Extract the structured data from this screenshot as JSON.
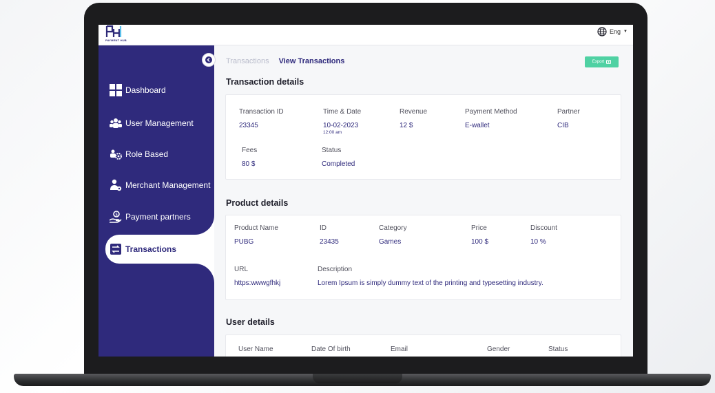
{
  "app": {
    "logo_text": "PAYMENT HUB",
    "language": "Eng"
  },
  "sidebar": {
    "items": [
      {
        "label": "Dashboard",
        "icon": "dashboard-icon"
      },
      {
        "label": "User Management",
        "icon": "users-icon"
      },
      {
        "label": "Role Based",
        "icon": "roles-icon"
      },
      {
        "label": "Merchant Management",
        "icon": "merchant-icon"
      },
      {
        "label": "Payment partners",
        "icon": "partner-icon"
      },
      {
        "label": "Transactions",
        "icon": "transactions-icon",
        "active": true
      }
    ]
  },
  "breadcrumb": {
    "parent": "Transactions",
    "current": "View Transactions"
  },
  "export_label": "Export",
  "transaction": {
    "title": "Transaction details",
    "fields": [
      {
        "label": "Transaction ID",
        "value": "23345"
      },
      {
        "label": "Time & Date",
        "value": "10-02-2023",
        "sub": "12:00 am"
      },
      {
        "label": "Revenue",
        "value": "12 $"
      },
      {
        "label": "Payment Method",
        "value": "E-wallet"
      },
      {
        "label": "Partner",
        "value": "CIB"
      },
      {
        "label": "Fees",
        "value": "80 $"
      },
      {
        "label": "Status",
        "value": "Completed"
      }
    ]
  },
  "product": {
    "title": "Product details",
    "fields": [
      {
        "label": "Product  Name",
        "value": "PUBG"
      },
      {
        "label": "ID",
        "value": "23435"
      },
      {
        "label": "Category",
        "value": "Games"
      },
      {
        "label": "Price",
        "value": "100 $"
      },
      {
        "label": "Discount",
        "value": "10 %"
      },
      {
        "label": "URL",
        "value": "https:wwwgfhkj"
      },
      {
        "label": "Description",
        "value": "Lorem Ipsum is simply dummy text of the printing and typesetting industry."
      }
    ]
  },
  "user": {
    "title": "User details",
    "columns": [
      "User Name",
      "Date Of birth",
      "Email",
      "Gender",
      "Status"
    ]
  },
  "colors": {
    "primary": "#2f2a7c",
    "accent": "#4fd1a3",
    "background": "#f6f7f9"
  }
}
